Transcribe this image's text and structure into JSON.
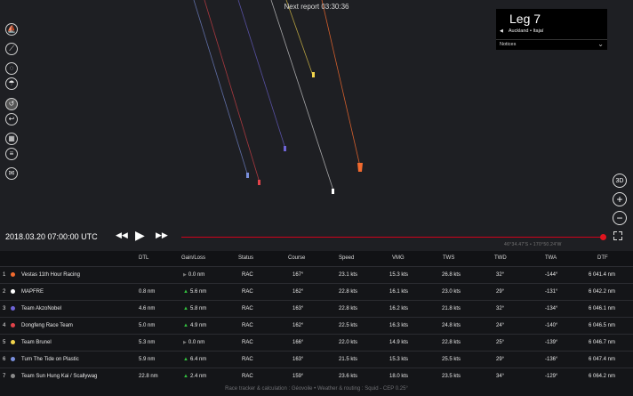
{
  "map": {
    "next_report": "Next report 03:30:36",
    "tracks": [
      {
        "team": "Vestas 11th Hour Racing",
        "color": "#f26a2e"
      },
      {
        "team": "MAPFRE",
        "color": "#ffffff"
      },
      {
        "team": "Team AkzoNobel",
        "color": "#6e64d6"
      },
      {
        "team": "Dongfeng Race Team",
        "color": "#e2434a"
      },
      {
        "team": "Team Brunel",
        "color": "#f2d44c"
      },
      {
        "team": "Turn The Tide on Plastic",
        "color": "#7a8fdc"
      }
    ]
  },
  "left_tools": [
    {
      "name": "boats-tool-icon",
      "glyph": "⛵"
    },
    {
      "name": "ruler-tool-icon",
      "glyph": "⟋"
    },
    {
      "name": "compass-tool-icon",
      "glyph": "◌"
    },
    {
      "name": "weather-tool-icon",
      "glyph": "☂"
    },
    {
      "name": "wind-tool-icon",
      "glyph": "↺"
    },
    {
      "name": "routing-tool-icon",
      "glyph": "↩"
    },
    {
      "name": "grid-tool-icon",
      "glyph": "▦"
    },
    {
      "name": "list-tool-icon",
      "glyph": "≡"
    },
    {
      "name": "mail-tool-icon",
      "glyph": "✉"
    }
  ],
  "leg_panel": {
    "title": "Leg 7",
    "route": "Auckland • Itajaí",
    "notices": "Notices"
  },
  "right_tools": {
    "view_3d": "3D",
    "zoom_in": "+",
    "zoom_out": "−"
  },
  "playback": {
    "datetime": "2018.03.20 07:00:00 UTC",
    "coordinates": "46°34.47'S • 170°50.24'W",
    "progress": 1.0
  },
  "table": {
    "columns": [
      "DTL",
      "Gain/Loss",
      "Status",
      "Course",
      "Speed",
      "VMG",
      "TWS",
      "TWD",
      "TWA",
      "DTF"
    ],
    "rows": [
      {
        "rank": "1",
        "team": "Vestas 11th Hour Racing",
        "color": "#f26a2e",
        "dtl": "",
        "gain_dir": "flat",
        "gain": "0.0 nm",
        "status": "RAC",
        "course": "167°",
        "speed": "23.1 kts",
        "vmg": "15.3 kts",
        "tws": "26.8 kts",
        "twd": "32°",
        "twa": "-144°",
        "dtf": "6 041.4 nm"
      },
      {
        "rank": "2",
        "team": "MAPFRE",
        "color": "#ffffff",
        "dtl": "0.8 nm",
        "gain_dir": "up",
        "gain": "5.6 nm",
        "status": "RAC",
        "course": "162°",
        "speed": "22.8 kts",
        "vmg": "16.1 kts",
        "tws": "23.0 kts",
        "twd": "29°",
        "twa": "-131°",
        "dtf": "6 042.2 nm"
      },
      {
        "rank": "3",
        "team": "Team AkzoNobel",
        "color": "#6e64d6",
        "dtl": "4.6 nm",
        "gain_dir": "up",
        "gain": "5.8 nm",
        "status": "RAC",
        "course": "163°",
        "speed": "22.8 kts",
        "vmg": "16.2 kts",
        "tws": "21.8 kts",
        "twd": "32°",
        "twa": "-134°",
        "dtf": "6 046.1 nm"
      },
      {
        "rank": "4",
        "team": "Dongfeng Race Team",
        "color": "#e2434a",
        "dtl": "5.0 nm",
        "gain_dir": "up",
        "gain": "4.9 nm",
        "status": "RAC",
        "course": "162°",
        "speed": "22.5 kts",
        "vmg": "16.3 kts",
        "tws": "24.8 kts",
        "twd": "24°",
        "twa": "-140°",
        "dtf": "6 046.5 nm"
      },
      {
        "rank": "5",
        "team": "Team Brunel",
        "color": "#f2d44c",
        "dtl": "5.3 nm",
        "gain_dir": "flat",
        "gain": "0.0 nm",
        "status": "RAC",
        "course": "166°",
        "speed": "22.0 kts",
        "vmg": "14.9 kts",
        "tws": "22.8 kts",
        "twd": "25°",
        "twa": "-139°",
        "dtf": "6 046.7 nm"
      },
      {
        "rank": "6",
        "team": "Turn The Tide on Plastic",
        "color": "#7a8fdc",
        "dtl": "5.9 nm",
        "gain_dir": "up",
        "gain": "6.4 nm",
        "status": "RAC",
        "course": "163°",
        "speed": "21.5 kts",
        "vmg": "15.3 kts",
        "tws": "25.5 kts",
        "twd": "29°",
        "twa": "-136°",
        "dtf": "6 047.4 nm"
      },
      {
        "rank": "7",
        "team": "Team Sun Hung Kai / Scallywag",
        "color": "#8a8a8a",
        "dtl": "22.8 nm",
        "gain_dir": "up",
        "gain": "2.4 nm",
        "status": "RAC",
        "course": "159°",
        "speed": "23.6 kts",
        "vmg": "18.0 kts",
        "tws": "23.5 kts",
        "twd": "34°",
        "twa": "-129°",
        "dtf": "6 064.2 nm"
      }
    ]
  },
  "footer": "Race tracker & calculation : Géovoile • Weather & routing : Squid - CEP 0.25°"
}
